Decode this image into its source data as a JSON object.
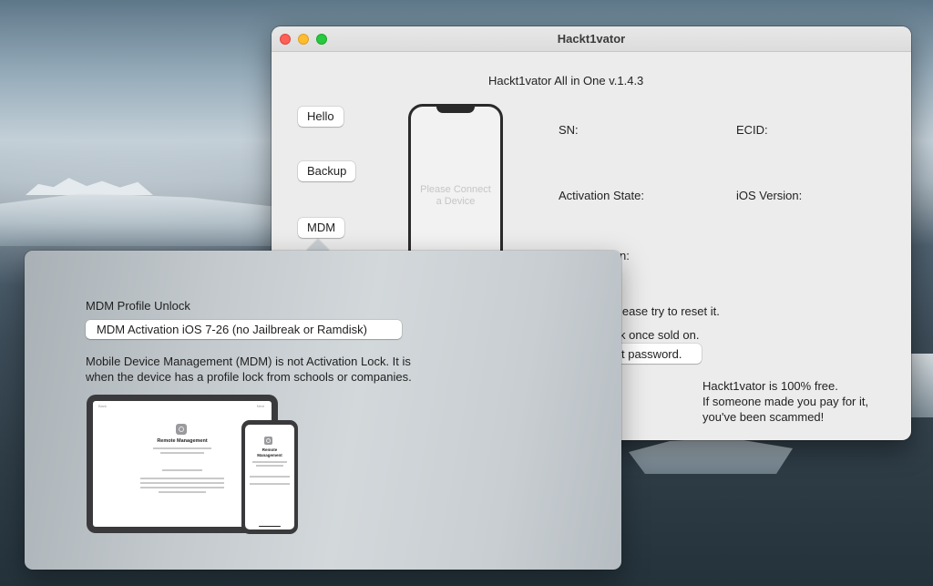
{
  "window": {
    "title": "Hackt1vator"
  },
  "app": {
    "heading": "Hackt1vator All in One v.1.4.3"
  },
  "sidebar": {
    "items": [
      {
        "label": "Hello"
      },
      {
        "label": "Backup"
      },
      {
        "label": "MDM"
      }
    ]
  },
  "device": {
    "placeholder_line1": "Please Connect",
    "placeholder_line2": "a Device"
  },
  "info": {
    "sn_label": "SN:",
    "ecid_label": "ECID:",
    "activation_state_label": "Activation State:",
    "ios_version_label": "iOS Version:"
  },
  "background_text": {
    "line1": "n:",
    "line2": "lease try to reset it.",
    "line3": "k once sold on.",
    "line4": "t password."
  },
  "free_note": {
    "line1": "Hackt1vator is 100% free.",
    "line2": "If someone made you pay for it,",
    "line3": "you've been scammed!"
  },
  "mdm_popover": {
    "title": "MDM Profile Unlock",
    "selected_option": "MDM Activation iOS 7-26 (no Jailbreak or Ramdisk)",
    "description_line1": "Mobile Device Management (MDM)  is not Activation Lock. It is",
    "description_line2": "when the device has a profile lock from schools or companies.",
    "illustration": {
      "ipad_status": "Back",
      "ipad_next": "Next",
      "ipad_title": "Remote Management",
      "iphone_title_line1": "Remote",
      "iphone_title_line2": "Management"
    }
  },
  "colors": {
    "close": "#fe5f57",
    "minimize": "#febc2e",
    "maximize": "#28c840"
  }
}
